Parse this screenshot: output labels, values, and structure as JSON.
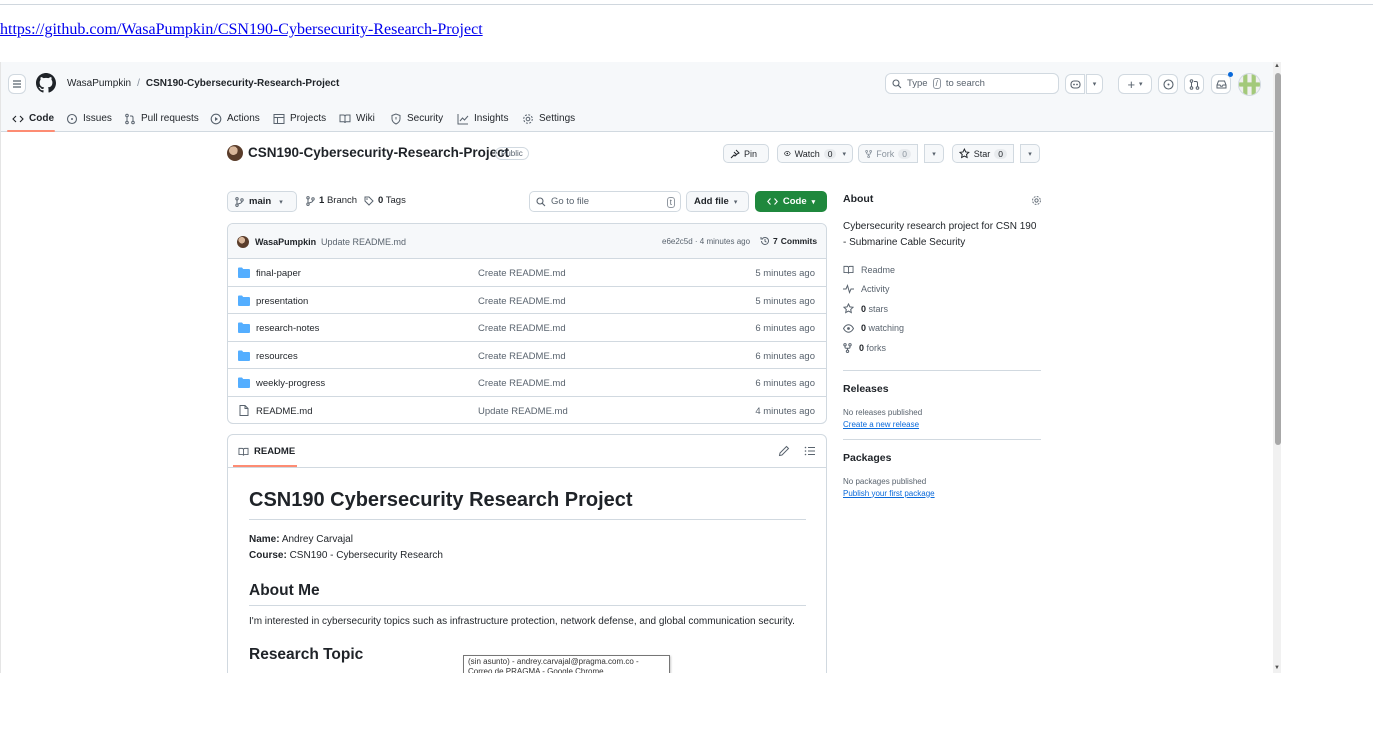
{
  "page": {
    "url_text": "https://github.com/WasaPumpkin/CSN190-Cybersecurity-Research-Project"
  },
  "header": {
    "owner": "WasaPumpkin",
    "separator": "/",
    "repo": "CSN190-Cybersecurity-Research-Project",
    "search_prefix": "Type",
    "search_key": "/",
    "search_suffix": "to search"
  },
  "tabs": [
    {
      "label": "Code",
      "icon": "code-icon",
      "active": true
    },
    {
      "label": "Issues",
      "icon": "issue-icon"
    },
    {
      "label": "Pull requests",
      "icon": "pull-request-icon"
    },
    {
      "label": "Actions",
      "icon": "play-icon"
    },
    {
      "label": "Projects",
      "icon": "table-icon"
    },
    {
      "label": "Wiki",
      "icon": "book-icon"
    },
    {
      "label": "Security",
      "icon": "shield-icon"
    },
    {
      "label": "Insights",
      "icon": "graph-icon"
    },
    {
      "label": "Settings",
      "icon": "gear-icon"
    }
  ],
  "repo": {
    "name": "CSN190-Cybersecurity-Research-Project",
    "visibility": "Public",
    "pin_label": "Pin",
    "watch_label": "Watch",
    "watch_count": "0",
    "fork_label": "Fork",
    "fork_count": "0",
    "star_label": "Star",
    "star_count": "0"
  },
  "toolbar": {
    "branch": "main",
    "branch_count": "1",
    "branch_label": "Branch",
    "tag_count": "0",
    "tag_label": "Tags",
    "goto_placeholder": "Go to file",
    "goto_key": "t",
    "add_file": "Add file",
    "code": "Code"
  },
  "commit": {
    "author": "WasaPumpkin",
    "message": "Update README.md",
    "meta": "e6e2c5d · 4 minutes ago",
    "commits_count": "7",
    "commits_label": "Commits"
  },
  "files": [
    {
      "name": "final-paper",
      "type": "dir",
      "message": "Create README.md",
      "age": "5 minutes ago"
    },
    {
      "name": "presentation",
      "type": "dir",
      "message": "Create README.md",
      "age": "5 minutes ago"
    },
    {
      "name": "research-notes",
      "type": "dir",
      "message": "Create README.md",
      "age": "6 minutes ago"
    },
    {
      "name": "resources",
      "type": "dir",
      "message": "Create README.md",
      "age": "6 minutes ago"
    },
    {
      "name": "weekly-progress",
      "type": "dir",
      "message": "Create README.md",
      "age": "6 minutes ago"
    },
    {
      "name": "README.md",
      "type": "file",
      "message": "Update README.md",
      "age": "4 minutes ago"
    }
  ],
  "readme": {
    "tab_label": "README",
    "title": "CSN190 Cybersecurity Research Project",
    "name_label": "Name:",
    "name_value": "Andrey Carvajal",
    "course_label": "Course:",
    "course_value": "CSN190 - Cybersecurity Research",
    "about_heading": "About Me",
    "about_text": "I'm interested in cybersecurity topics such as infrastructure protection, network defense, and global communication security.",
    "next_heading": "Research Topic"
  },
  "sidebar": {
    "about_title": "About",
    "description": "Cybersecurity research project for CSN 190 - Submarine Cable Security",
    "readme_label": "Readme",
    "activity_label": "Activity",
    "stars_count": "0",
    "stars_label": "stars",
    "watching_count": "0",
    "watching_label": "watching",
    "forks_count": "0",
    "forks_label": "forks",
    "releases_title": "Releases",
    "releases_empty": "No releases published",
    "releases_link": "Create a new release",
    "packages_title": "Packages",
    "packages_empty": "No packages published",
    "packages_link": "Publish your first package"
  },
  "tooltip": {
    "text": "(sin asunto) - andrey.carvajal@pragma.com.co - Correo de PRAGMA - Google Chrome"
  },
  "colors": {
    "accent_green": "#1f883d",
    "tab_underline": "#fd8c73",
    "link_blue": "#0969da",
    "folder_blue": "#54aeff"
  }
}
